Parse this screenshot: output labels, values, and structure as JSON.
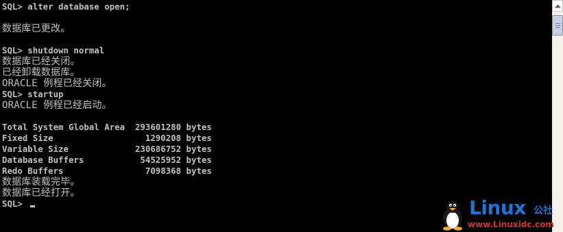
{
  "console": {
    "lines": [
      "SQL> alter database open;",
      "",
      "数据库已更改。",
      "",
      "SQL> shutdown normal",
      "数据库已经关闭。",
      "已经卸载数据库。",
      "ORACLE 例程已经关闭。",
      "SQL> startup",
      "ORACLE 例程已经启动。",
      "",
      "Total System Global Area  293601280 bytes",
      "Fixed Size                  1290208 bytes",
      "Variable Size             230686752 bytes",
      "Database Buffers           54525952 bytes",
      "Redo Buffers                7098368 bytes",
      "数据库装载完毕。",
      "数据库已经打开。",
      "SQL> "
    ]
  },
  "watermark": {
    "brand": "Linux",
    "brand_cn": "公社",
    "site": "www.Linuxidc.com",
    "icon": "tux-penguin-icon"
  },
  "colors": {
    "background": "#000000",
    "text": "#c0c0c0",
    "brand_blue": "#1878d8",
    "site_red": "#d23030"
  }
}
